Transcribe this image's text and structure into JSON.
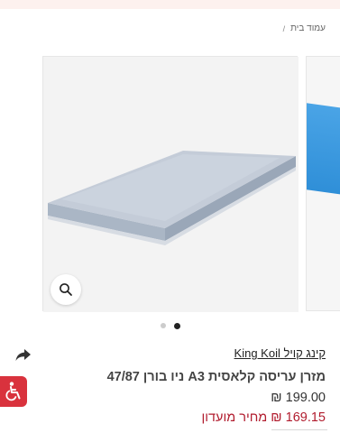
{
  "breadcrumb": {
    "home_label": "עמוד בית",
    "separator": "/"
  },
  "gallery": {
    "image_alt": "mattress-image",
    "dots_count": 2,
    "active_dot": 2
  },
  "product": {
    "brand": "קינג קויל King Koil",
    "title": "מזרן עריסה קלאסית A3 ניו בורן 47/87",
    "price_regular": "199.00 ₪",
    "price_club_amount": "169.15 ₪",
    "price_club_label": "מחיר מועדון"
  },
  "colors": {
    "accent_red": "#b11c2e",
    "a11y_red": "#d9323d"
  },
  "icons": {
    "share": "share-icon",
    "zoom": "search-icon",
    "accessibility": "wheelchair-icon"
  }
}
